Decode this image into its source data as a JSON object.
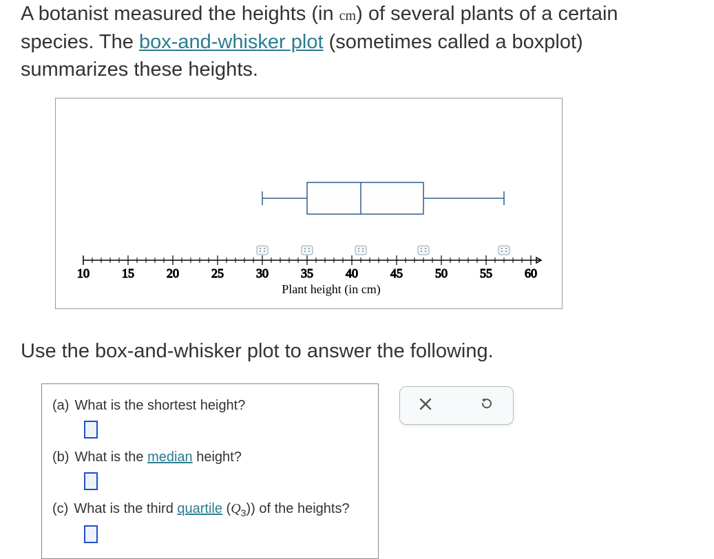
{
  "problem": {
    "text1": "A botanist measured the heights (in ",
    "unit": "cm",
    "text2": ") of several plants of a certain species. The ",
    "link1": "box-and-whisker plot",
    "text3": " (sometimes called a boxplot) summarizes these heights."
  },
  "instruction": "Use the box-and-whisker plot to answer the following.",
  "chart_data": {
    "type": "boxplot",
    "title": "",
    "xlabel": "Plant height (in cm)",
    "ylabel": "",
    "xlim": [
      10,
      60
    ],
    "ticks": [
      10,
      15,
      20,
      25,
      30,
      35,
      40,
      45,
      50,
      55,
      60
    ],
    "min": 30,
    "q1": 35,
    "median": 41,
    "q3": 48,
    "max": 57,
    "marker_positions": [
      30,
      35,
      41,
      48,
      57
    ]
  },
  "questions": {
    "a": {
      "label": "(a)",
      "text": "What is the shortest height?"
    },
    "b": {
      "label": "(b)",
      "text_before": "What is the ",
      "link": "median",
      "text_after": " height?"
    },
    "c": {
      "label": "(c)",
      "text_before": "What is the third ",
      "link": "quartile",
      "text_q": " (Q",
      "sub": "3",
      "text_after": ") of the heights?"
    }
  },
  "controls": {
    "clear": "×",
    "reset": "↺"
  }
}
